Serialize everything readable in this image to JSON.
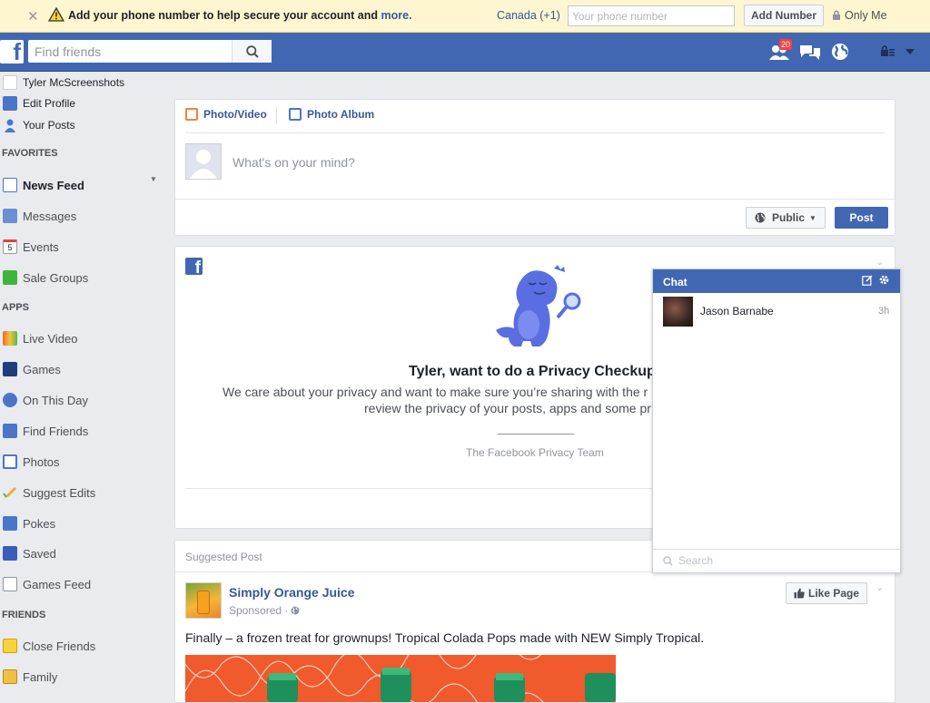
{
  "banner": {
    "message": "Add your phone number to help secure your account and",
    "more_link": "more.",
    "country": "Canada (+1)",
    "phone_placeholder": "Your phone number",
    "add_button": "Add Number",
    "privacy": "Only Me"
  },
  "topbar": {
    "search_placeholder": "Find friends",
    "friend_requests_count": "20"
  },
  "left_nav": {
    "profile": "Tyler McScreenshots",
    "edit_profile": "Edit Profile",
    "your_posts": "Your Posts",
    "favorites_header": "FAVORITES",
    "favorites": [
      "News Feed",
      "Messages",
      "Events",
      "Sale Groups"
    ],
    "apps_header": "APPS",
    "apps": [
      "Live Video",
      "Games",
      "On This Day",
      "Find Friends",
      "Photos",
      "Suggest Edits",
      "Pokes",
      "Saved",
      "Games Feed"
    ],
    "friends_header": "FRIENDS",
    "friends": [
      "Close Friends",
      "Family"
    ],
    "events_day": "5"
  },
  "composer": {
    "photo_video": "Photo/Video",
    "photo_album": "Photo Album",
    "placeholder": "What's on your mind?",
    "audience": "Public",
    "post_button": "Post"
  },
  "privacy_card": {
    "title": "Tyler, want to do a Privacy Checkup",
    "body_line1": "We care about your privacy and want to make sure you’re sharing with the r",
    "body_line2": "review the privacy of your posts, apps and some pr",
    "signature": "The Facebook Privacy Team"
  },
  "suggested_post": {
    "label": "Suggested Post",
    "page_name": "Simply Orange Juice",
    "sponsored": "Sponsored ·",
    "like_button": "Like Page",
    "text": "Finally – a frozen treat for grownups! Tropical Colada Pops made with NEW Simply Tropical."
  },
  "chat": {
    "title": "Chat",
    "contact_name": "Jason Barnabe",
    "contact_time": "3h",
    "search_placeholder": "Search"
  },
  "colors": {
    "brand_blue": "#4267b2",
    "banner_bg": "#fdf6d0",
    "page_bg": "#e9ebee",
    "link": "#365899"
  }
}
